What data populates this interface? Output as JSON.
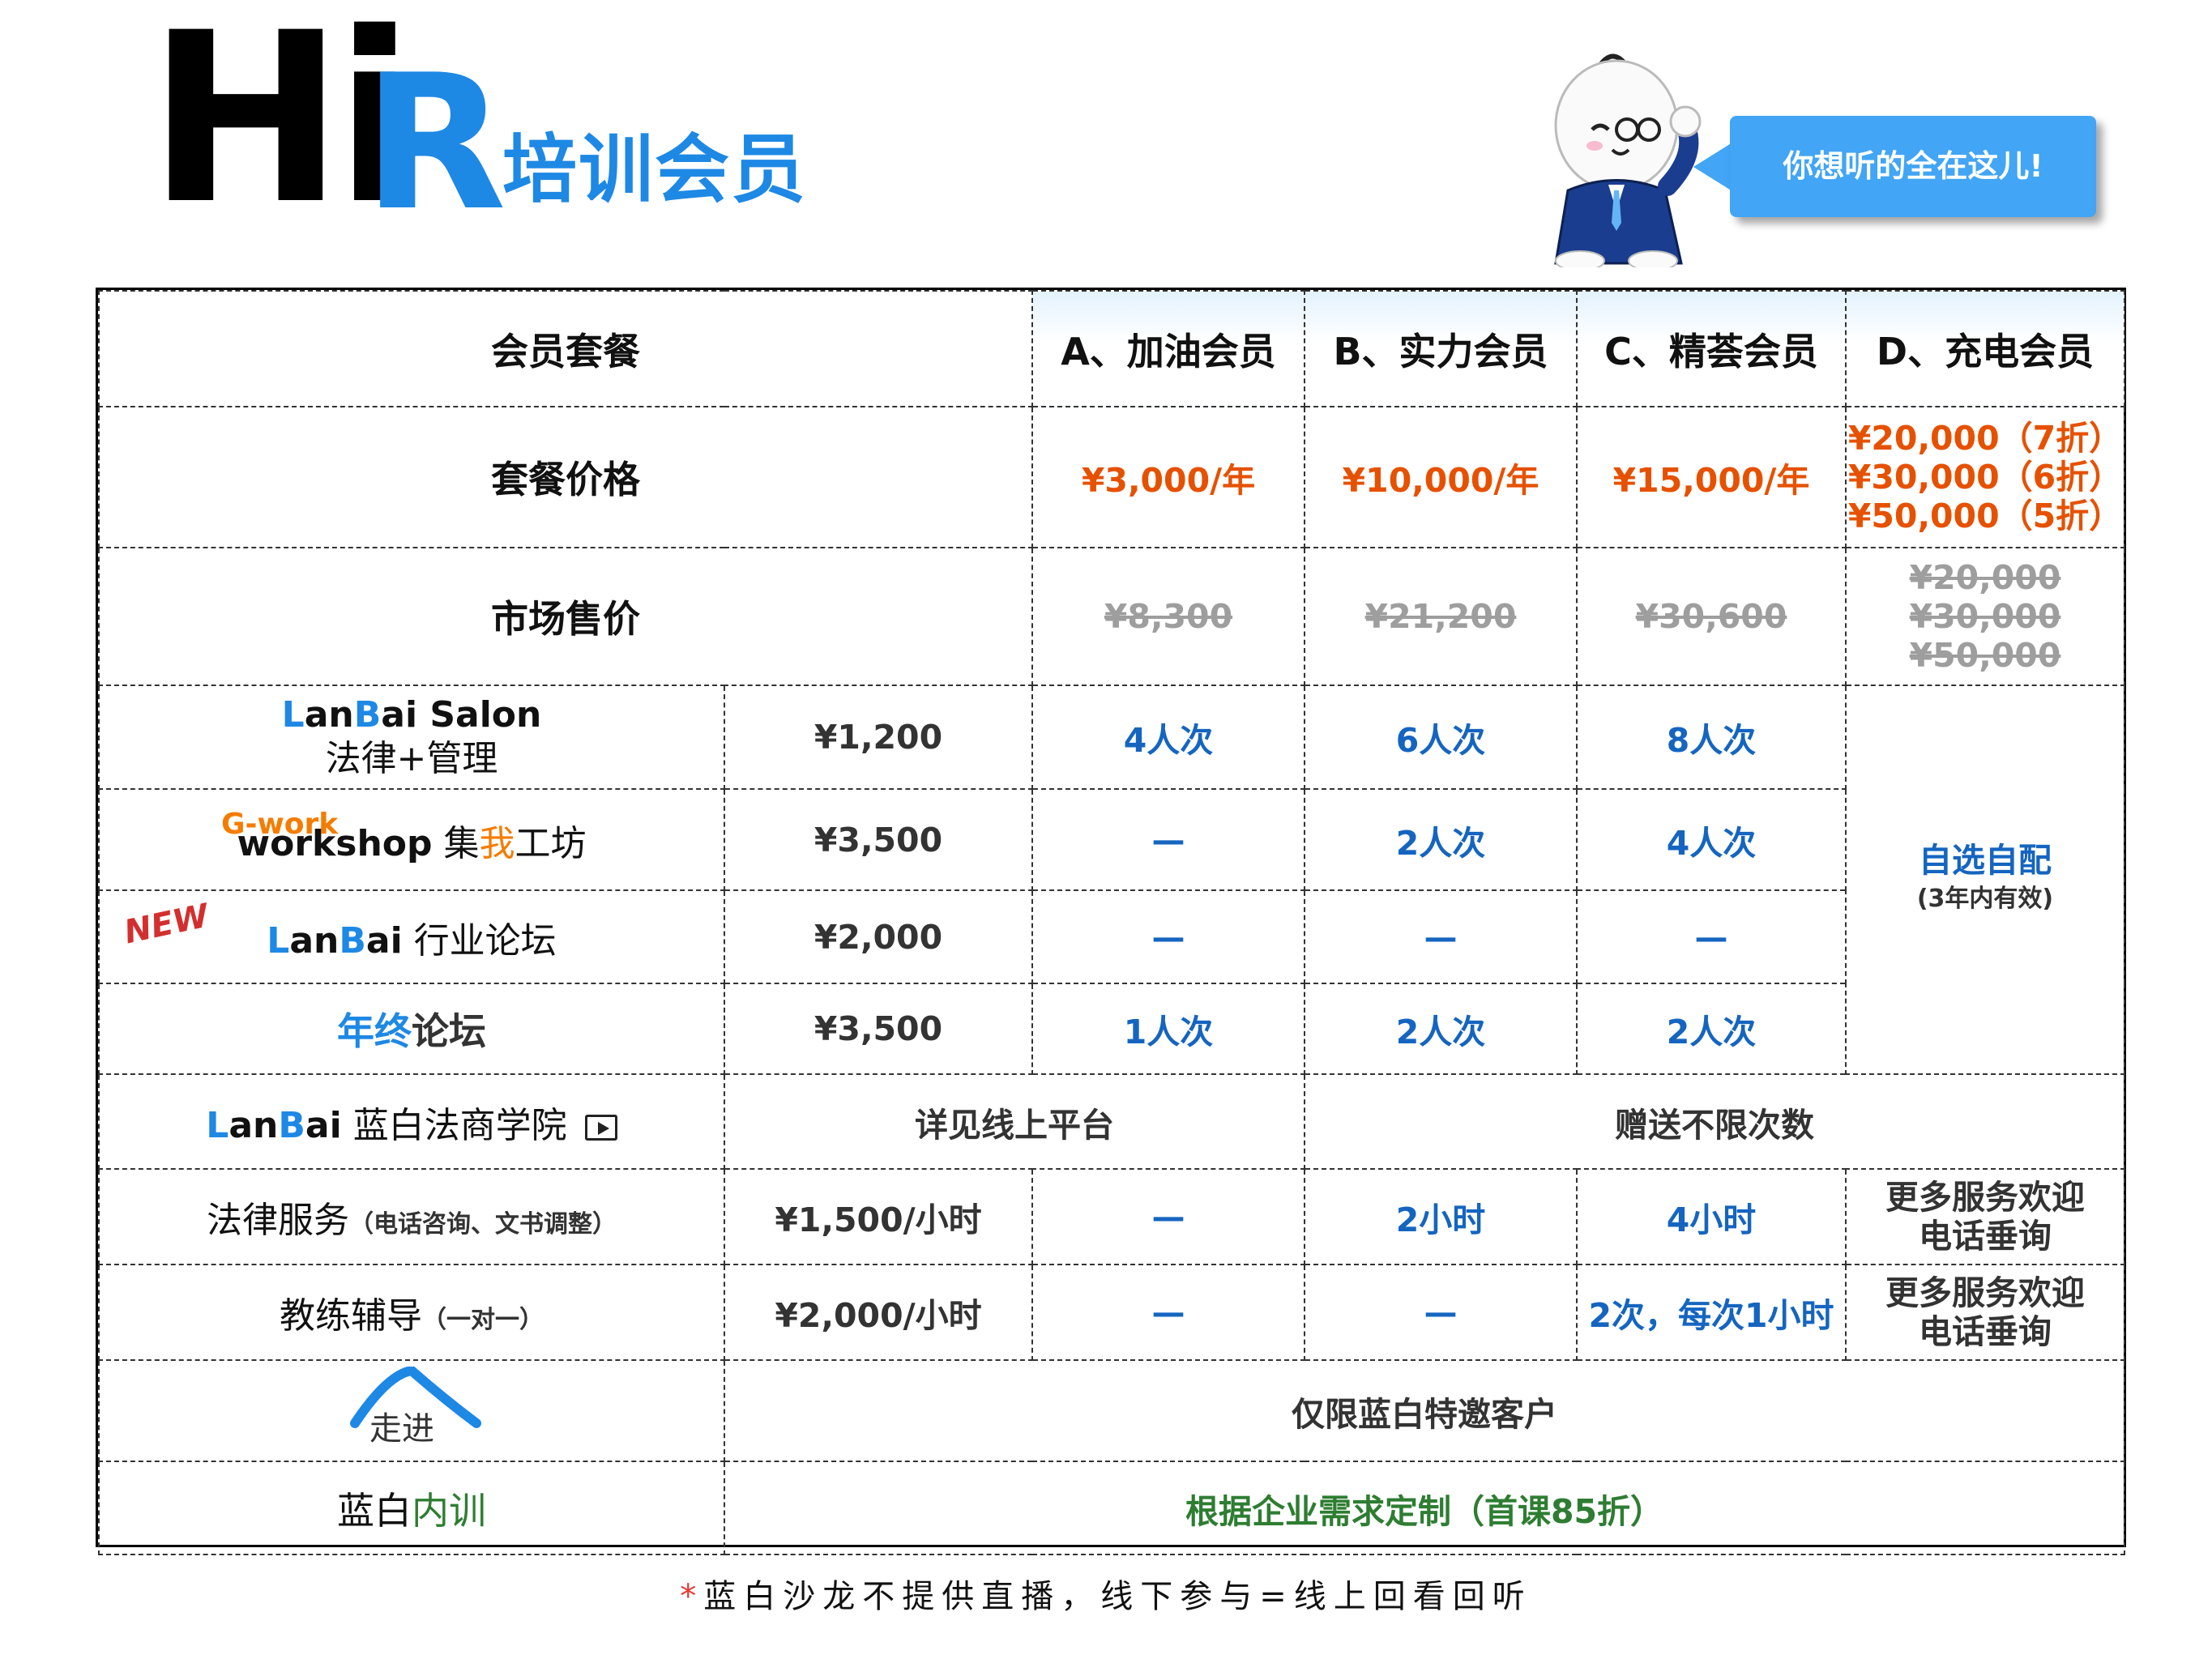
{
  "header": {
    "logo_hi": "Hi",
    "logo_r": "R",
    "subtitle": "培训会员",
    "bubble_text": "你想听的全在这儿!"
  },
  "table": {
    "col_title": "会员套餐",
    "plans": [
      "A、加油会员",
      "B、实力会员",
      "C、精荟会员",
      "D、充电会员"
    ],
    "price_label": "套餐价格",
    "prices": [
      "¥3,000/年",
      "¥10,000/年",
      "¥15,000/年"
    ],
    "price_d": [
      "¥20,000（7折）",
      "¥30,000（6折）",
      "¥50,000（5折）"
    ],
    "market_label": "市场售价",
    "market": [
      "¥8,300",
      "¥21,200",
      "¥30,600"
    ],
    "market_d": [
      "¥20,000",
      "¥30,000",
      "¥50,000"
    ],
    "salon": {
      "brand_first": "L",
      "brand_mid": "an",
      "brand_b": "B",
      "brand_rest": "ai Salon",
      "sub": "法律+管理",
      "price": "¥1,200",
      "values": [
        "4人次",
        "6人次",
        "8人次"
      ]
    },
    "workshop": {
      "gwork": "G-work",
      "name": "workshop",
      "cn_1": "集",
      "cn_2": "我",
      "cn_3": "工坊",
      "price": "¥3,500",
      "values": [
        "—",
        "2人次",
        "4人次"
      ]
    },
    "forum": {
      "badge": "NEW",
      "brand_l": "L",
      "brand_an": "an",
      "brand_b": "B",
      "brand_ai": "ai",
      "name": "行业论坛",
      "price": "¥2,000",
      "values": [
        "—",
        "—",
        "—"
      ]
    },
    "yearend": {
      "name_blue": "年终",
      "name_rest": "论坛",
      "price": "¥3,500",
      "values": [
        "1人次",
        "2人次",
        "2人次"
      ]
    },
    "d_custom": {
      "main": "自选自配",
      "note": "(3年内有效)"
    },
    "academy": {
      "brand_l": "L",
      "brand_an": "an",
      "brand_b": "B",
      "brand_ai": "ai",
      "name": "蓝白法商学院",
      "online": "详见线上平台",
      "gift": "赠送不限次数"
    },
    "legal": {
      "name": "法律服务",
      "note": "（电话咨询、文书调整）",
      "price": "¥1,500/小时",
      "values": [
        "—",
        "2小时",
        "4小时"
      ],
      "d": [
        "更多服务欢迎",
        "电话垂询"
      ]
    },
    "coach": {
      "name": "教练辅导",
      "note": "（一对一）",
      "price": "¥2,000/小时",
      "values": [
        "—",
        "—",
        "2次，每次1小时"
      ],
      "d": [
        "更多服务欢迎",
        "电话垂询"
      ]
    },
    "walk": {
      "name": "走进",
      "value": "仅限蓝白特邀客户"
    },
    "internal": {
      "name_1": "蓝白",
      "name_2": "内训",
      "value": "根据企业需求定制（首课85折）"
    }
  },
  "footer": {
    "star": "*",
    "text": "蓝白沙龙不提供直播，线下参与=线上回看回听"
  },
  "colors": {
    "brand_blue": "#1E88E5",
    "price_orange": "#E65100",
    "value_blue": "#1565C0",
    "green": "#2E7D32"
  }
}
